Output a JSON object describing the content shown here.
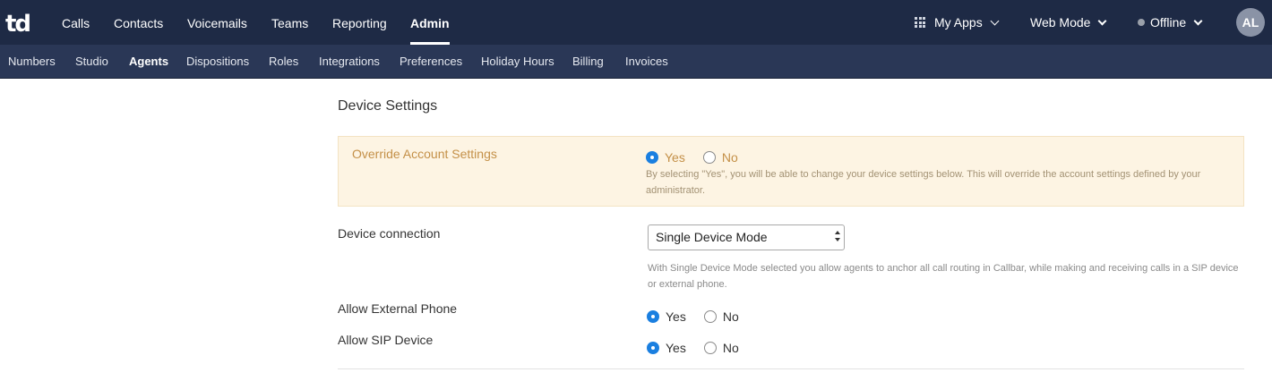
{
  "topbar": {
    "logo": "td",
    "nav": [
      "Calls",
      "Contacts",
      "Voicemails",
      "Teams",
      "Reporting",
      "Admin"
    ],
    "active_nav": "Admin",
    "my_apps": "My Apps",
    "web_mode": "Web Mode",
    "status": "Offline",
    "avatar_initials": "AL"
  },
  "subnav": {
    "items": [
      "Numbers",
      "Studio",
      "Agents",
      "Dispositions",
      "Roles",
      "Integrations",
      "Preferences",
      "Holiday Hours",
      "Billing",
      "Invoices"
    ],
    "active": "Agents"
  },
  "device_settings": {
    "title": "Device Settings",
    "override": {
      "label": "Override Account Settings",
      "yes": "Yes",
      "no": "No",
      "selected": "Yes",
      "help_line1": "By selecting \"Yes\", you will be able to change your device settings below. This will override the account settings defined by your",
      "help_line2": "administrator."
    },
    "device_connection": {
      "label": "Device connection",
      "value": "Single Device Mode",
      "help_line1": "With Single Device Mode selected you allow agents to anchor all call routing in Callbar, while making and receiving calls in a SIP device",
      "help_line2": "or external phone."
    },
    "allow_external_phone": {
      "label": "Allow External Phone",
      "yes": "Yes",
      "no": "No",
      "selected": "Yes"
    },
    "allow_sip_device": {
      "label": "Allow SIP Device",
      "yes": "Yes",
      "no": "No",
      "selected": "Yes"
    }
  },
  "colors": {
    "topbar": "#1e2a45",
    "subbar": "#2a3756",
    "override_bg": "#fdf4e3",
    "override_text": "#c49048",
    "radio_selected": "#1a7fe0"
  }
}
